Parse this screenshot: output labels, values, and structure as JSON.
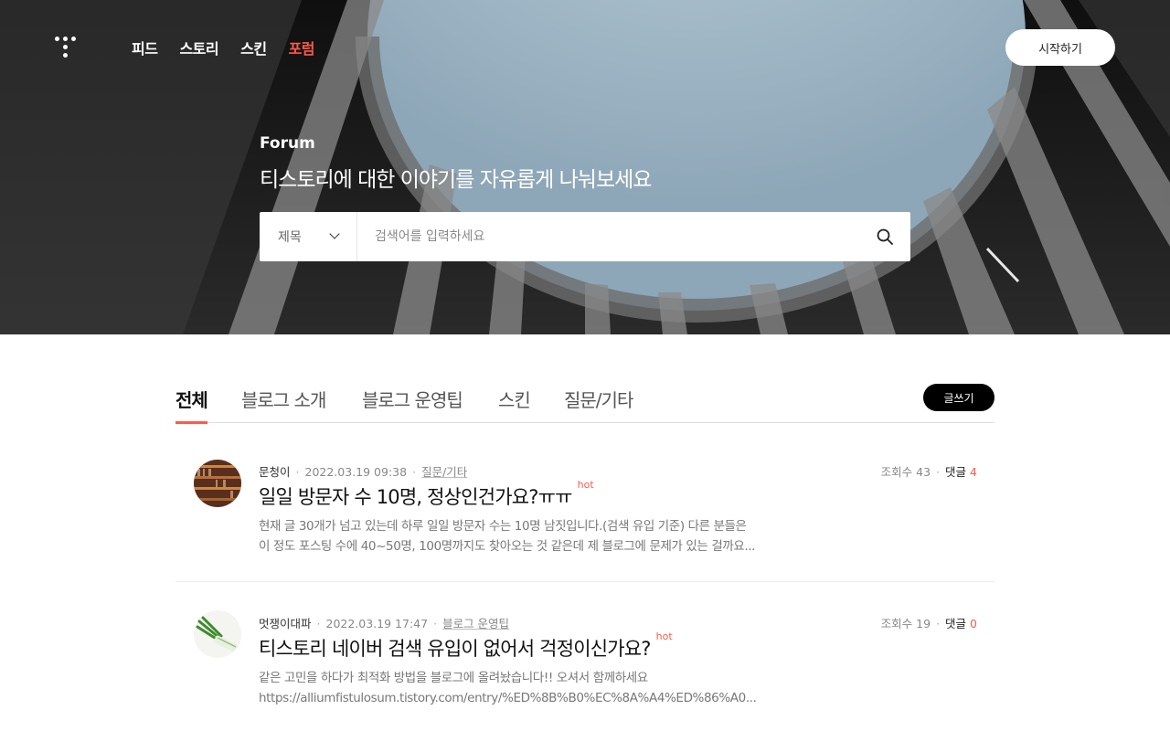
{
  "nav": {
    "items": [
      {
        "label": "피드",
        "active": false
      },
      {
        "label": "스토리",
        "active": false
      },
      {
        "label": "스킨",
        "active": false
      },
      {
        "label": "포럼",
        "active": true
      }
    ],
    "start_label": "시작하기"
  },
  "hero": {
    "label": "Forum",
    "subtitle": "티스토리에 대한 이야기를 자유롭게 나눠보세요"
  },
  "search": {
    "select_value": "제목",
    "placeholder": "검색어를 입력하세요",
    "icon": "search-icon"
  },
  "tabs": {
    "items": [
      "전체",
      "블로그 소개",
      "블로그 운영팁",
      "스킨",
      "질문/기타"
    ],
    "active": "전체",
    "write_label": "글쓰기"
  },
  "posts": [
    {
      "author": "문청이",
      "date": "2022.03.19 09:38",
      "category": "질문/기타",
      "views_label": "조회수 43",
      "comments_label": "댓글",
      "comments_count": "4",
      "title": "일일 방문자 수 10명, 정상인건가요?ㅠㅠ",
      "badge": "hot",
      "excerpt_line1": "현재 글 30개가 넘고 있는데 하루 일일 방문자 수는 10명 남짓입니다.(검색 유입 기준) 다른 분들은",
      "excerpt_line2": "이 정도 포스팅 수에 40~50명, 100명까지도 찾아오는 것 같은데 제 블로그에 문제가 있는 걸까요..."
    },
    {
      "author": "멋쟁이대파",
      "date": "2022.03.19 17:47",
      "category": "블로그 운영팁",
      "views_label": "조회수 19",
      "comments_label": "댓글",
      "comments_count": "0",
      "title": "티스토리 네이버 검색 유입이 없어서 걱정이신가요?",
      "badge": "hot",
      "excerpt_line1": "같은 고민을 하다가 최적화 방법을 블로그에 올려놨습니다!! 오셔서 함께하세요",
      "excerpt_line2": "https://alliumfistulosum.tistory.com/entry/%ED%8B%B0%EC%8A%A4%ED%86%A0..."
    }
  ],
  "colors": {
    "accent": "#ff5a4a",
    "sky": "#a9bfcc"
  }
}
